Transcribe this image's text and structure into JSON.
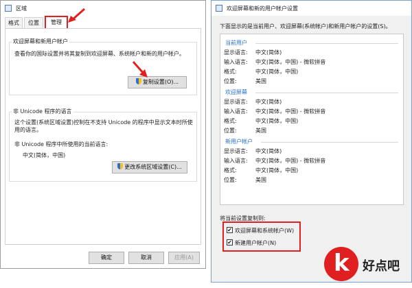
{
  "left": {
    "title": "区域",
    "tabs": [
      {
        "label": "格式"
      },
      {
        "label": "位置"
      },
      {
        "label": "管理"
      }
    ],
    "welcome_group": {
      "title": "欢迎屏幕和新用户帐户",
      "desc": "查看你的国际设置并将其复制到欢迎屏幕、系统帐户和新的用户帐户。",
      "copy_button": "复制设置(O)..."
    },
    "unicode_group": {
      "title": "非 Unicode 程序的语言",
      "desc_line1": "这个设置(系统区域设置)控制在不支持 Unicode 的程序中显示文本时所使",
      "desc_line2": "用的语言。",
      "current_label": "非 Unicode 程序中所使用的当前语言:",
      "current_value": "中文(简体，中国)",
      "change_button": "更改系统区域设置(C)..."
    },
    "ok": "确定",
    "cancel": "取消",
    "apply": "应用(A)"
  },
  "right": {
    "title": "欢迎屏幕和新的用户帐户设置",
    "intro": "下面显示的是当前用户、欢迎屏幕(系统帐户)和新用户帐户的设置(S)。",
    "sections": [
      {
        "name": "当前用户",
        "rows": [
          {
            "label": "显示语言:",
            "value": "中文(简体)"
          },
          {
            "label": "输入语言:",
            "value": "中文(简体，中国) - 微软拼音"
          },
          {
            "label": "格式:",
            "value": "中文(简体，中国)"
          },
          {
            "label": "位置:",
            "value": "美国"
          }
        ]
      },
      {
        "name": "欢迎屏幕",
        "rows": [
          {
            "label": "显示语言:",
            "value": "中文(简体)"
          },
          {
            "label": "输入语言:",
            "value": "中文(简体，中国) - 微软拼音"
          },
          {
            "label": "格式:",
            "value": "中文(简体，中国)"
          },
          {
            "label": "位置:",
            "value": "美国"
          }
        ]
      },
      {
        "name": "新用户帐户",
        "rows": [
          {
            "label": "显示语言:",
            "value": "中文(简体)"
          },
          {
            "label": "输入语言:",
            "value": "中文(简体，中国) - 微软拼音"
          },
          {
            "label": "格式:",
            "value": "中文(简体，中国)"
          },
          {
            "label": "位置:",
            "value": "美国"
          }
        ]
      }
    ],
    "copy_to": "将当前设置复制到:",
    "check1": "欢迎屏幕和系统帐户(W)",
    "check2": "新建用户帐户(N)",
    "check_mark": "✔"
  },
  "watermark": {
    "logo_letter": "k",
    "text": "好点吧"
  },
  "colors": {
    "accent": "#2a6fd0",
    "highlight": "#e02020",
    "logo_red": "#e02020"
  }
}
